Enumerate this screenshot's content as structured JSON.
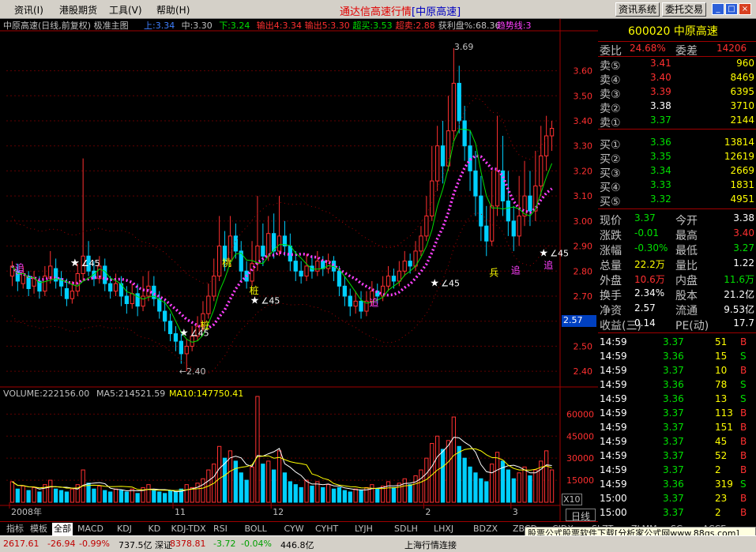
{
  "menu": [
    "资讯(I)",
    "港股期货",
    "工具(V)",
    "帮助(H)"
  ],
  "app_title": "通达信高速行情",
  "app_title_symbol": "[中原高速]",
  "sys_buttons": [
    "资讯系统",
    "委托交易"
  ],
  "window_buttons": [
    "_",
    "□",
    "×"
  ],
  "chart_header": {
    "name": "中原高速(日线,前复权) 极准主图",
    "items": [
      {
        "label": "上:3.34",
        "color": "#4080ff"
      },
      {
        "label": "中:3.30",
        "color": "#c0c0c0"
      },
      {
        "label": "下:3.24",
        "color": "#00e000"
      },
      {
        "label": "输出4:3.34",
        "color": "#ff3030"
      },
      {
        "label": "输出5:3.30",
        "color": "#ff3030"
      },
      {
        "label": "超买:3.53",
        "color": "#00e000"
      },
      {
        "label": "超卖:2.88",
        "color": "#ff3030"
      },
      {
        "label": "获利盘%:68.36",
        "color": "#c0c0c0"
      },
      {
        "label": "趋势线:3",
        "color": "#ff40ff"
      }
    ]
  },
  "volume_header": {
    "volume": "VOLUME:222156.00",
    "ma5": "MA5:214521.59",
    "ma10": "MA10:147750.41"
  },
  "chart_data": [
    {
      "type": "candlestick",
      "title": "中原高速(日线,前复权) 极准主图",
      "y_ticks": [
        2.4,
        2.5,
        2.6,
        2.7,
        2.8,
        2.9,
        3.0,
        3.1,
        3.2,
        3.3,
        3.4,
        3.5,
        3.6
      ],
      "ylim": [
        2.35,
        3.75
      ],
      "annotations": {
        "high": "3.69",
        "low": "←2.40",
        "angle": [
          "∠45",
          "∠45",
          "∠45",
          "∠45",
          "∠45",
          "∠"
        ],
        "signals": [
          "追",
          "追",
          "追",
          "追",
          "桩",
          "桩",
          "桃",
          "兵"
        ]
      },
      "current_price_label": "2.57",
      "x_labels": [
        "2008年",
        "11",
        "12",
        "2",
        "3"
      ],
      "candles": [
        [
          2.78,
          2.82,
          2.74,
          2.84
        ],
        [
          2.8,
          2.76,
          2.72,
          2.83
        ],
        [
          2.75,
          2.79,
          2.73,
          2.82
        ],
        [
          2.78,
          2.73,
          2.7,
          2.8
        ],
        [
          2.74,
          2.77,
          2.71,
          2.8
        ],
        [
          2.76,
          2.72,
          2.69,
          2.78
        ],
        [
          2.72,
          2.78,
          2.7,
          2.82
        ],
        [
          2.77,
          2.82,
          2.75,
          2.88
        ],
        [
          2.81,
          2.76,
          2.73,
          2.85
        ],
        [
          2.77,
          2.74,
          2.7,
          2.8
        ],
        [
          2.73,
          2.69,
          2.66,
          2.77
        ],
        [
          2.69,
          2.72,
          2.67,
          2.76
        ],
        [
          2.72,
          2.79,
          2.7,
          2.83
        ],
        [
          2.79,
          2.86,
          2.76,
          3.25
        ],
        [
          2.86,
          2.8,
          2.78,
          2.92
        ],
        [
          2.8,
          2.77,
          2.74,
          2.84
        ],
        [
          2.77,
          2.82,
          2.75,
          2.86
        ],
        [
          2.82,
          2.75,
          2.72,
          2.85
        ],
        [
          2.75,
          2.72,
          2.69,
          2.78
        ],
        [
          2.72,
          2.75,
          2.7,
          2.79
        ],
        [
          2.75,
          2.7,
          2.66,
          2.78
        ],
        [
          2.7,
          2.67,
          2.63,
          2.74
        ],
        [
          2.67,
          2.71,
          2.65,
          2.75
        ],
        [
          2.71,
          2.66,
          2.62,
          2.75
        ],
        [
          2.66,
          2.7,
          2.64,
          2.78
        ],
        [
          2.7,
          2.74,
          2.68,
          2.8
        ],
        [
          2.74,
          2.69,
          2.66,
          2.78
        ],
        [
          2.69,
          2.64,
          2.61,
          2.72
        ],
        [
          2.64,
          2.6,
          2.56,
          2.68
        ],
        [
          2.6,
          2.55,
          2.52,
          2.63
        ],
        [
          2.55,
          2.52,
          2.48,
          2.58
        ],
        [
          2.52,
          2.47,
          2.43,
          2.55
        ],
        [
          2.47,
          2.5,
          2.4,
          2.53
        ],
        [
          2.5,
          2.54,
          2.48,
          2.58
        ],
        [
          2.54,
          2.58,
          2.52,
          2.62
        ],
        [
          2.58,
          2.63,
          2.56,
          2.68
        ],
        [
          2.63,
          2.7,
          2.61,
          2.75
        ],
        [
          2.7,
          2.78,
          2.68,
          2.85
        ],
        [
          2.78,
          2.9,
          2.76,
          3.02
        ],
        [
          2.9,
          2.84,
          2.8,
          2.96
        ],
        [
          2.84,
          2.94,
          2.82,
          3.02
        ],
        [
          2.94,
          2.88,
          2.85,
          2.99
        ],
        [
          2.88,
          2.8,
          2.76,
          2.92
        ],
        [
          2.8,
          2.76,
          2.73,
          2.84
        ],
        [
          2.76,
          2.83,
          2.74,
          2.92
        ],
        [
          2.83,
          2.9,
          2.8,
          3.1
        ],
        [
          2.9,
          2.86,
          2.82,
          2.99
        ],
        [
          2.86,
          2.95,
          2.84,
          3.02
        ],
        [
          2.95,
          2.88,
          2.85,
          3.03
        ],
        [
          2.88,
          2.94,
          2.86,
          3.1
        ],
        [
          2.94,
          2.9,
          2.86,
          3.0
        ],
        [
          2.9,
          2.84,
          2.8,
          2.95
        ],
        [
          2.84,
          2.8,
          2.76,
          2.88
        ],
        [
          2.8,
          2.78,
          2.75,
          2.84
        ],
        [
          2.78,
          2.82,
          2.76,
          2.87
        ],
        [
          2.82,
          2.8,
          2.77,
          2.86
        ],
        [
          2.8,
          2.84,
          2.78,
          2.88
        ],
        [
          2.84,
          2.81,
          2.78,
          2.86
        ],
        [
          2.81,
          2.84,
          2.79,
          2.87
        ],
        [
          2.84,
          2.8,
          2.76,
          2.86
        ],
        [
          2.8,
          2.74,
          2.7,
          2.82
        ],
        [
          2.74,
          2.7,
          2.66,
          2.78
        ],
        [
          2.7,
          2.66,
          2.62,
          2.73
        ],
        [
          2.66,
          2.68,
          2.63,
          2.72
        ],
        [
          2.68,
          2.64,
          2.61,
          2.72
        ],
        [
          2.64,
          2.68,
          2.62,
          2.72
        ],
        [
          2.68,
          2.72,
          2.66,
          2.76
        ],
        [
          2.72,
          2.7,
          2.67,
          2.75
        ],
        [
          2.7,
          2.74,
          2.68,
          2.78
        ],
        [
          2.74,
          2.78,
          2.72,
          2.82
        ],
        [
          2.78,
          2.76,
          2.73,
          2.81
        ],
        [
          2.76,
          2.8,
          2.74,
          2.84
        ],
        [
          2.8,
          2.84,
          2.78,
          2.88
        ],
        [
          2.84,
          2.82,
          2.79,
          2.87
        ],
        [
          2.82,
          2.88,
          2.8,
          2.92
        ],
        [
          2.88,
          2.94,
          2.86,
          2.98
        ],
        [
          2.94,
          3.02,
          2.92,
          3.1
        ],
        [
          3.02,
          3.16,
          3.0,
          3.3
        ],
        [
          3.16,
          3.3,
          3.12,
          3.38
        ],
        [
          3.3,
          3.22,
          3.15,
          3.4
        ],
        [
          3.22,
          3.36,
          3.2,
          3.5
        ],
        [
          3.36,
          3.55,
          3.32,
          3.69
        ],
        [
          3.55,
          3.4,
          3.35,
          3.62
        ],
        [
          3.4,
          3.3,
          3.24,
          3.46
        ],
        [
          3.3,
          3.2,
          3.12,
          3.36
        ],
        [
          3.2,
          3.1,
          3.02,
          3.28
        ],
        [
          3.1,
          2.98,
          2.92,
          3.18
        ],
        [
          2.98,
          2.92,
          2.86,
          3.06
        ],
        [
          2.92,
          3.06,
          2.9,
          3.2
        ],
        [
          3.06,
          3.2,
          3.02,
          3.42
        ],
        [
          3.2,
          3.08,
          3.02,
          3.34
        ],
        [
          3.08,
          3.0,
          2.94,
          3.2
        ],
        [
          3.0,
          2.94,
          2.88,
          3.06
        ],
        [
          2.94,
          3.02,
          2.9,
          3.18
        ],
        [
          3.02,
          3.1,
          2.98,
          3.24
        ],
        [
          3.1,
          3.04,
          2.98,
          3.2
        ],
        [
          3.04,
          3.14,
          3.0,
          3.28
        ],
        [
          3.14,
          3.26,
          3.1,
          3.38
        ],
        [
          3.26,
          3.34,
          3.2,
          3.42
        ],
        [
          3.34,
          3.37,
          3.28,
          3.4
        ]
      ]
    },
    {
      "type": "bar",
      "title": "VOLUME",
      "y_ticks": [
        15000,
        30000,
        45000,
        60000
      ],
      "ylim": [
        0,
        72000
      ],
      "values": [
        14000,
        9000,
        11000,
        8000,
        10000,
        7000,
        12000,
        15000,
        9000,
        8000,
        7000,
        9000,
        12000,
        22000,
        13000,
        9000,
        11000,
        8000,
        7000,
        9000,
        8000,
        7000,
        9000,
        6000,
        10000,
        12000,
        8000,
        7000,
        6000,
        8000,
        7000,
        9000,
        12000,
        10000,
        13000,
        16000,
        22000,
        26000,
        38000,
        30000,
        35000,
        28000,
        20000,
        15000,
        24000,
        72000,
        26000,
        28000,
        22000,
        35000,
        20000,
        14000,
        12000,
        10000,
        15000,
        11000,
        14000,
        10000,
        12000,
        9000,
        10000,
        8000,
        7000,
        9000,
        8000,
        10000,
        12000,
        9000,
        11000,
        14000,
        10000,
        13000,
        16000,
        12000,
        18000,
        22000,
        30000,
        40000,
        45000,
        36000,
        42000,
        58000,
        38000,
        30000,
        24000,
        20000,
        16000,
        14000,
        26000,
        34000,
        28000,
        22000,
        16000,
        20000,
        24000,
        18000,
        22000,
        28000,
        35000,
        22000
      ]
    }
  ],
  "vol_labels": {
    "x10": "X10",
    "day": "日线"
  },
  "right_panel": {
    "code": "600020",
    "name": "中原高速",
    "weibi_label": "委比",
    "weibi": "24.68%",
    "weicha_label": "委差",
    "weicha": "14206",
    "asks": [
      {
        "label": "卖⑤",
        "price": "3.41",
        "vol": "960"
      },
      {
        "label": "卖④",
        "price": "3.40",
        "vol": "8469"
      },
      {
        "label": "卖③",
        "price": "3.39",
        "vol": "6395"
      },
      {
        "label": "卖②",
        "price": "3.38",
        "vol": "3710"
      },
      {
        "label": "卖①",
        "price": "3.37",
        "vol": "2144"
      }
    ],
    "bids": [
      {
        "label": "买①",
        "price": "3.36",
        "vol": "13814"
      },
      {
        "label": "买②",
        "price": "3.35",
        "vol": "12619"
      },
      {
        "label": "买③",
        "price": "3.34",
        "vol": "2669"
      },
      {
        "label": "买④",
        "price": "3.33",
        "vol": "1831"
      },
      {
        "label": "买⑤",
        "price": "3.32",
        "vol": "4951"
      }
    ],
    "stats": [
      {
        "l1": "现价",
        "v1": "3.37",
        "c1": "c-grn",
        "l2": "今开",
        "v2": "3.38",
        "c2": "c-wht"
      },
      {
        "l1": "涨跌",
        "v1": "-0.01",
        "c1": "c-grn",
        "l2": "最高",
        "v2": "3.40",
        "c2": "c-red"
      },
      {
        "l1": "涨幅",
        "v1": "-0.30%",
        "c1": "c-grn",
        "l2": "最低",
        "v2": "3.27",
        "c2": "c-grn"
      },
      {
        "l1": "总量",
        "v1": "22.2万",
        "c1": "c-yel",
        "l2": "量比",
        "v2": "1.22",
        "c2": "c-wht"
      },
      {
        "l1": "外盘",
        "v1": "10.6万",
        "c1": "c-red",
        "l2": "内盘",
        "v2": "11.6万",
        "c2": "c-grn"
      },
      {
        "l1": "换手",
        "v1": "2.34%",
        "c1": "c-wht",
        "l2": "股本",
        "v2": "21.2亿",
        "c2": "c-wht"
      },
      {
        "l1": "净资",
        "v1": "2.57",
        "c1": "c-wht",
        "l2": "流通",
        "v2": "9.53亿",
        "c2": "c-wht"
      },
      {
        "l1": "收益(三)",
        "v1": "0.14",
        "c1": "c-wht",
        "l2": "PE(动)",
        "v2": "17.7",
        "c2": "c-wht"
      }
    ],
    "ticks": [
      {
        "t": "14:59",
        "p": "3.37",
        "pc": "c-grn",
        "v": "51",
        "s": "B",
        "sc": "c-red"
      },
      {
        "t": "14:59",
        "p": "3.36",
        "pc": "c-grn",
        "v": "15",
        "s": "S",
        "sc": "c-grn"
      },
      {
        "t": "14:59",
        "p": "3.37",
        "pc": "c-grn",
        "v": "10",
        "s": "B",
        "sc": "c-red"
      },
      {
        "t": "14:59",
        "p": "3.36",
        "pc": "c-grn",
        "v": "78",
        "s": "S",
        "sc": "c-grn"
      },
      {
        "t": "14:59",
        "p": "3.36",
        "pc": "c-grn",
        "v": "13",
        "s": "S",
        "sc": "c-grn"
      },
      {
        "t": "14:59",
        "p": "3.37",
        "pc": "c-grn",
        "v": "113",
        "s": "B",
        "sc": "c-red"
      },
      {
        "t": "14:59",
        "p": "3.37",
        "pc": "c-grn",
        "v": "151",
        "s": "B",
        "sc": "c-red"
      },
      {
        "t": "14:59",
        "p": "3.37",
        "pc": "c-grn",
        "v": "45",
        "s": "B",
        "sc": "c-red"
      },
      {
        "t": "14:59",
        "p": "3.37",
        "pc": "c-grn",
        "v": "52",
        "s": "B",
        "sc": "c-red"
      },
      {
        "t": "14:59",
        "p": "3.37",
        "pc": "c-grn",
        "v": "2",
        "s": "B",
        "sc": "c-red"
      },
      {
        "t": "14:59",
        "p": "3.36",
        "pc": "c-grn",
        "v": "319",
        "s": "S",
        "sc": "c-grn"
      },
      {
        "t": "15:00",
        "p": "3.37",
        "pc": "c-grn",
        "v": "23",
        "s": "B",
        "sc": "c-red"
      },
      {
        "t": "15:00",
        "p": "3.37",
        "pc": "c-grn",
        "v": "2",
        "s": "B",
        "sc": "c-red"
      }
    ]
  },
  "tabs": [
    "指标",
    "模板",
    "全部",
    "MACD",
    "KDJ",
    "KD",
    "KDJ-TDX",
    "RSI",
    "BOLL",
    "CYW",
    "CYHT",
    "LYJH",
    "SDLH",
    "LHXJ",
    "BDZX",
    "ZBCD",
    "CJDX",
    "SLZT",
    "ZLMM",
    "SG-LB",
    "ACCE"
  ],
  "ad_text": "股票公式股票软件下载[分析家公式网www.88gs.com]",
  "statusbar": [
    "2617.61",
    "-26.94",
    "-0.99%",
    "737.5亿 深证",
    "8378.81",
    "-3.72",
    "-0.04%",
    "446.8亿",
    "上海行情连接"
  ]
}
